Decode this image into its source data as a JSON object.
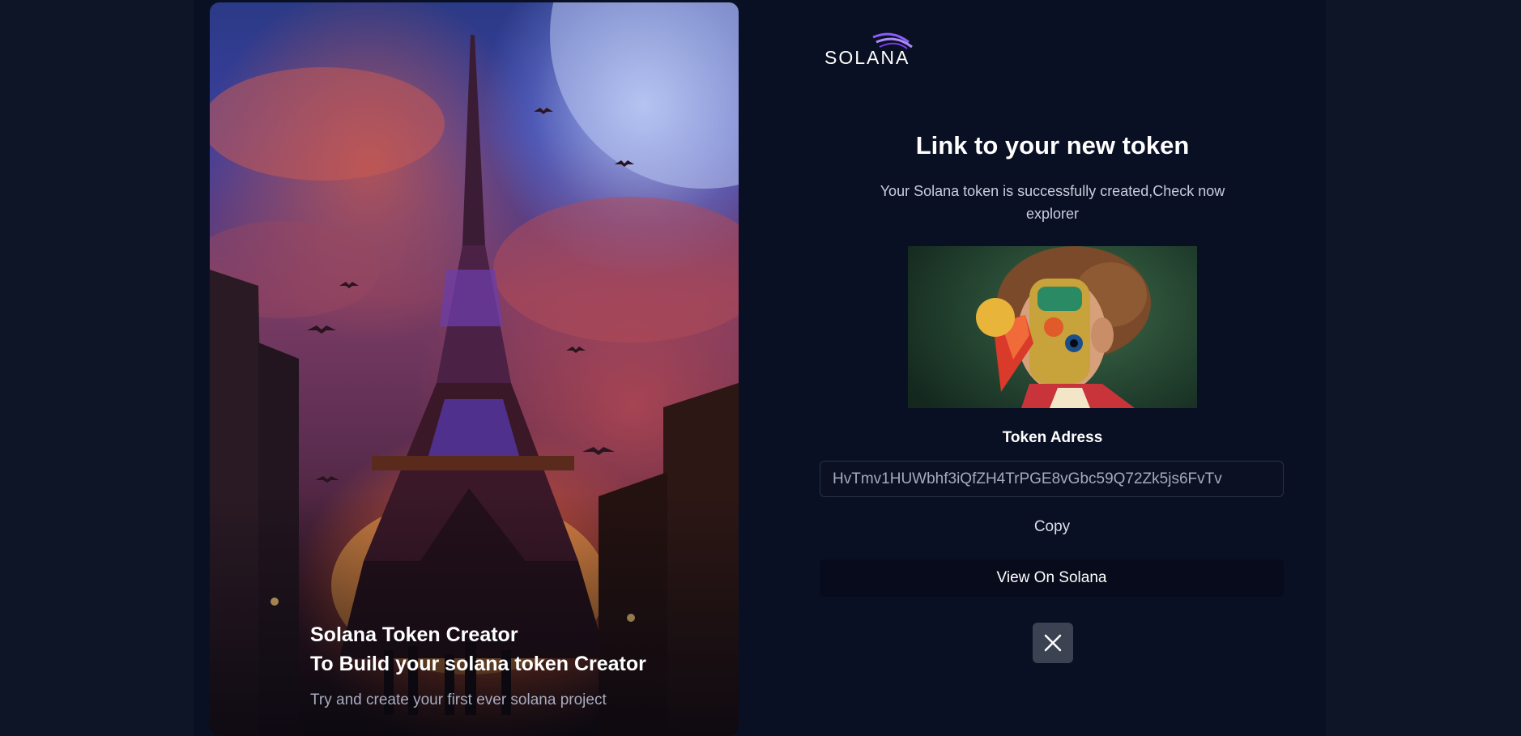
{
  "hero": {
    "title_line1": "Solana Token Creator",
    "title_line2": "To Build your solana token Creator",
    "subtitle": "Try and create your first ever solana project"
  },
  "brand": {
    "logo_text": "SOLANA",
    "accent_color": "#8b5cf6"
  },
  "modal": {
    "title": "Link to your new token",
    "description": "Your Solana token is successfully created,Check now explorer",
    "token_address_label": "Token Adress",
    "token_address": "HvTmv1HUWbhf3iQfZH4TrPGE8vGbc59Q72Zk5js6FvTv",
    "copy_label": "Copy",
    "view_label": "View On Solana"
  },
  "icons": {
    "close": "close-icon"
  }
}
